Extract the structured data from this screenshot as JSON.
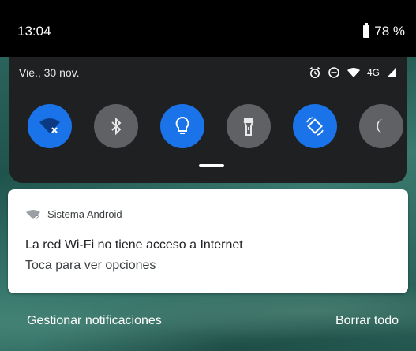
{
  "status_bar": {
    "time": "13:04",
    "battery": "78 %"
  },
  "quick_settings": {
    "date": "Vie., 30 nov.",
    "network_type": "4G",
    "status_icons": [
      "alarm-icon",
      "do-not-disturb-icon",
      "wifi-no-internet-icon",
      "cellular-signal-icon"
    ],
    "tiles": [
      {
        "icon": "wifi-no-internet-icon",
        "state": "on"
      },
      {
        "icon": "bluetooth-icon",
        "state": "off"
      },
      {
        "icon": "lightbulb-icon",
        "state": "on"
      },
      {
        "icon": "flashlight-icon",
        "state": "off"
      },
      {
        "icon": "auto-rotate-icon",
        "state": "on"
      },
      {
        "icon": "night-mode-icon",
        "state": "off"
      }
    ]
  },
  "notification": {
    "app_name": "Sistema Android",
    "title": "La red Wi-Fi no tiene acceso a Internet",
    "text": "Toca para ver opciones"
  },
  "footer": {
    "manage_label": "Gestionar notificaciones",
    "clear_label": "Borrar todo"
  },
  "colors": {
    "accent": "#1a73e8",
    "tile_off": "#5f6164",
    "panel_bg": "#1f2022"
  }
}
